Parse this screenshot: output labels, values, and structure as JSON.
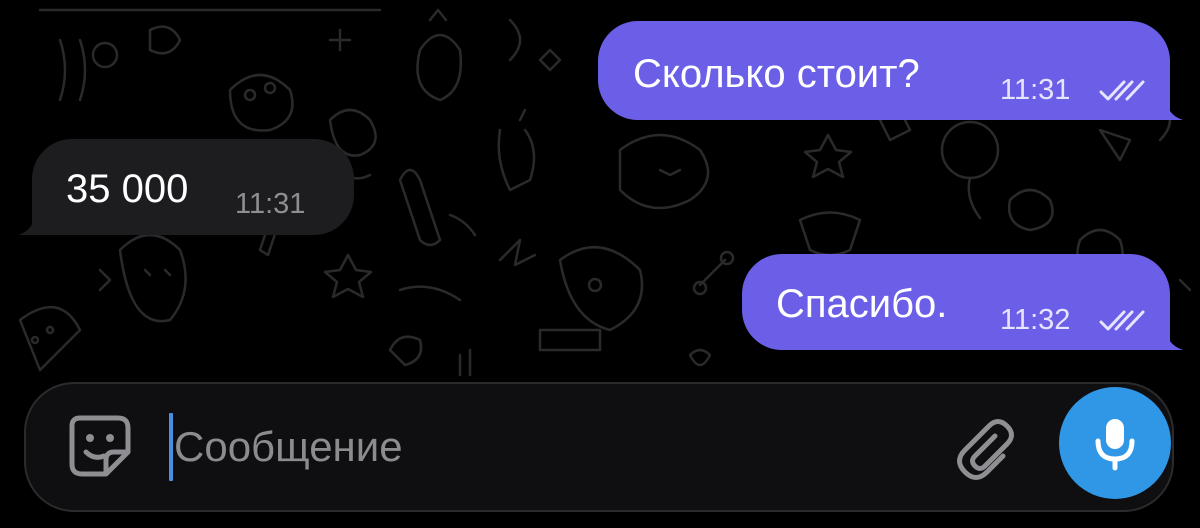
{
  "messages": [
    {
      "direction": "outgoing",
      "text": "Сколько стоит?",
      "time": "11:31",
      "status_icon": "double-check-icon"
    },
    {
      "direction": "incoming",
      "text": "35 000",
      "time": "11:31"
    },
    {
      "direction": "outgoing",
      "text": "Спасибо.",
      "time": "11:32",
      "status_icon": "double-check-icon"
    }
  ],
  "composer": {
    "placeholder": "Сообщение",
    "left_icon": "sticker-icon",
    "attach_icon": "paperclip-icon",
    "send_icon": "microphone-icon"
  },
  "colors": {
    "background": "#000000",
    "outgoing_bubble": "#6a5fe6",
    "incoming_bubble": "#1d1d20",
    "mic_button": "#2f97e6",
    "caret": "#4a8fe0"
  }
}
